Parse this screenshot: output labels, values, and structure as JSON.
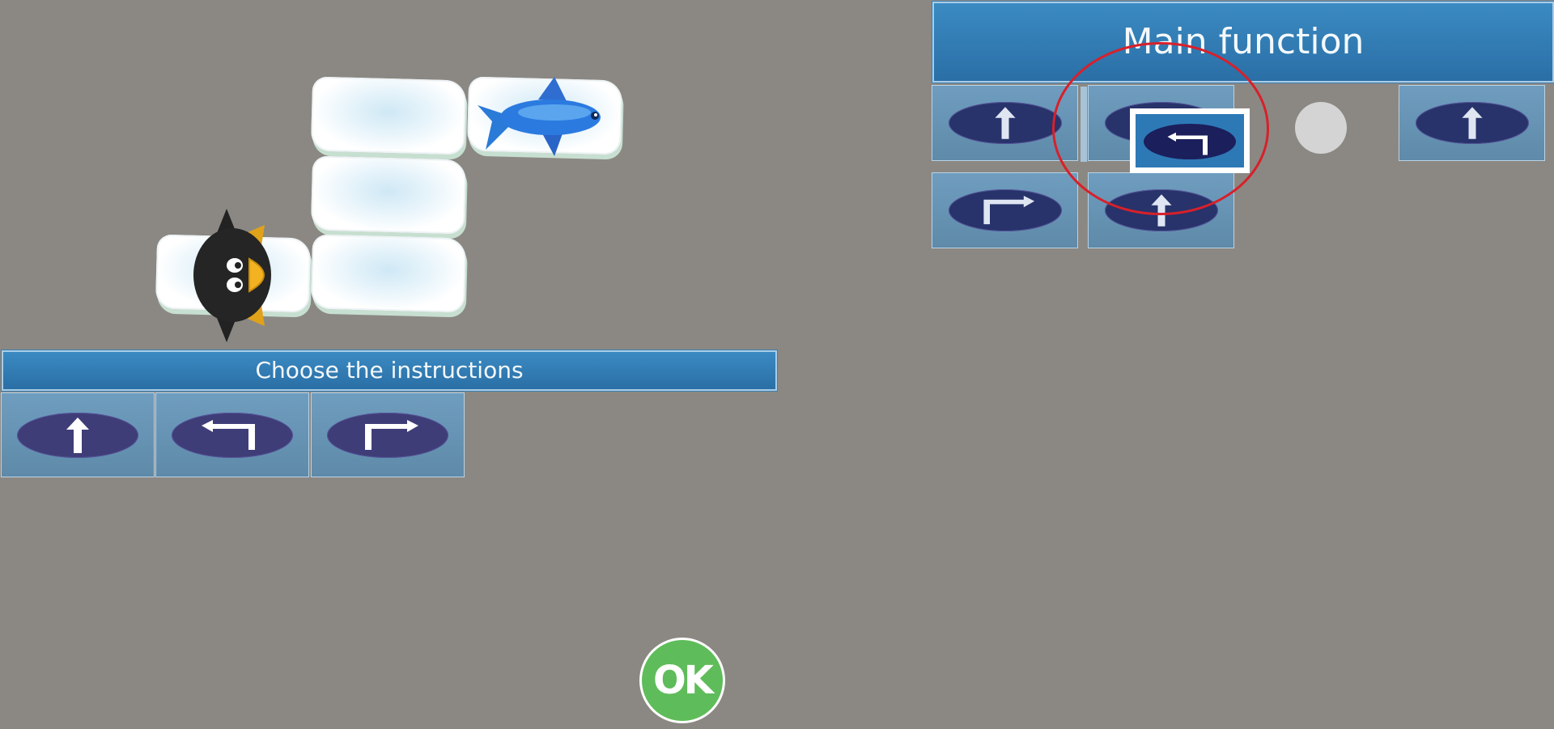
{
  "instructions_panel": {
    "title": "Choose the instructions",
    "items": [
      {
        "icon": "forward-arrow-icon"
      },
      {
        "icon": "turn-left-arrow-icon"
      },
      {
        "icon": "turn-right-arrow-icon"
      }
    ]
  },
  "main_function": {
    "title": "Main function",
    "row1": [
      "forward-arrow-icon",
      "turn-left-arrow-icon",
      "forward-arrow-icon"
    ],
    "row2": [
      "turn-right-arrow-icon",
      "forward-arrow-icon"
    ],
    "dragged_item": "turn-left-arrow-icon"
  },
  "ok_button": {
    "label": "OK"
  },
  "colors": {
    "background": "#8b8883",
    "banner": "#2f7bb3",
    "ok": "#5fbc5a",
    "highlight": "#d8202a"
  }
}
